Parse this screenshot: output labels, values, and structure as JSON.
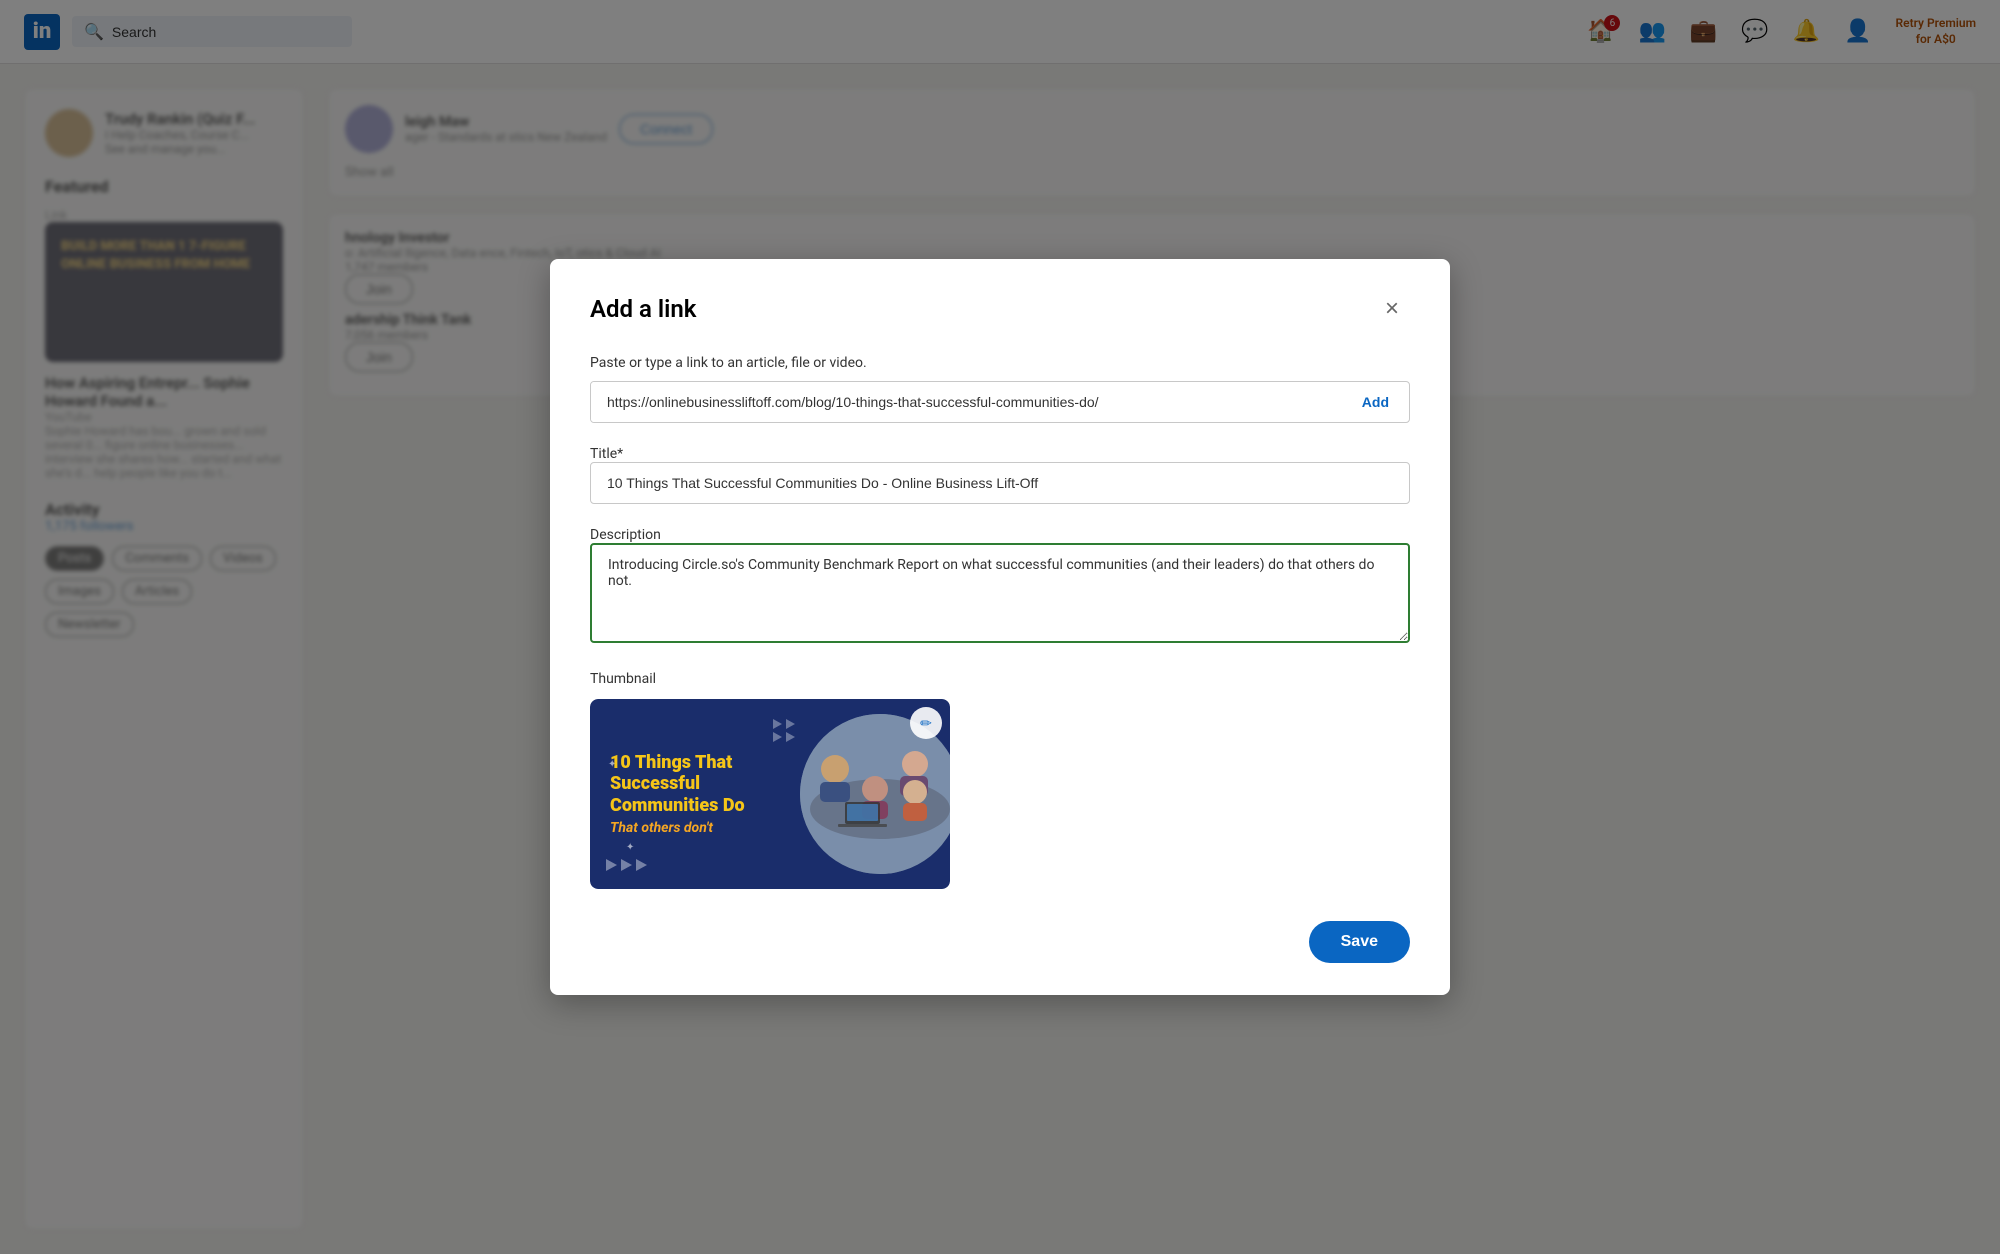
{
  "nav": {
    "logo": "in",
    "search_placeholder": "Search",
    "search_value": "Search",
    "premium_link_line1": "Retry Premium",
    "premium_link_line2": "for A$0",
    "icons": [
      {
        "name": "home-icon",
        "badge": "6",
        "symbol": "🏠"
      },
      {
        "name": "people-icon",
        "badge": null,
        "symbol": "👥"
      },
      {
        "name": "briefcase-icon",
        "badge": null,
        "symbol": "💼"
      },
      {
        "name": "chat-icon",
        "badge": null,
        "symbol": "💬"
      },
      {
        "name": "bell-icon",
        "badge": null,
        "symbol": "🔔"
      },
      {
        "name": "avatar-icon",
        "badge": null,
        "symbol": "👤"
      }
    ]
  },
  "background": {
    "user_name": "Trudy Rankin (Quiz F...",
    "user_tagline": "I Help Coaches, Course C...",
    "user_manage": "See and manage you...",
    "featured_title": "Featured",
    "link_label": "Link",
    "featured_card_text": "BUILD MORE THAN 1 7-FIGURE ONLINE BUSINESS FROM HOME",
    "card_main_title": "How Aspiring Entrepr... Sophie Howard Found a...",
    "card_source": "YouTube",
    "card_desc": "Sophie Howard has bou... grown and sold several 0... figure online businesses... interview she shares how... started and what she's d... help people like you do t...",
    "activity_title": "Activity",
    "followers": "1,175 followers",
    "tabs": [
      "Posts",
      "Comments",
      "Videos",
      "Images",
      "Articles",
      "Newsletter"
    ],
    "active_tab": "Posts",
    "suggestions": [
      {
        "name": "leigh Maw",
        "role": "ager - Standards at stics New Zealand",
        "action": "Connect"
      }
    ],
    "show_all": "Show all",
    "groups": [
      {
        "name": "hnology Investor",
        "detail": "o: Artificial lligence, Data ence, Fintech, IoT, otics & Cloud AI",
        "members": "1,747 members",
        "action": "Join"
      },
      {
        "name": "adership Think Tank",
        "members": "7,056 members",
        "action": "Join"
      }
    ]
  },
  "modal": {
    "title": "Add a link",
    "close_label": "×",
    "url_label": "Paste or type a link to an article, file or video.",
    "url_value": "https://onlinebusinessliftoff.com/blog/10-things-that-successful-communities-do/",
    "add_button_label": "Add",
    "title_field_label": "Title*",
    "title_value": "10 Things That Successful Communities Do - Online Business Lift-Off",
    "desc_field_label": "Description",
    "desc_value": "Introducing Circle.so's Community Benchmark Report on what successful communities (and their leaders) do that others do not.",
    "thumbnail_label": "Thumbnail",
    "thumbnail_text_line1": "10 Things That",
    "thumbnail_text_line2": "Successful",
    "thumbnail_text_line3": "Communities Do",
    "thumbnail_text_italic": "That others don't",
    "edit_icon": "✏",
    "save_button_label": "Save"
  }
}
